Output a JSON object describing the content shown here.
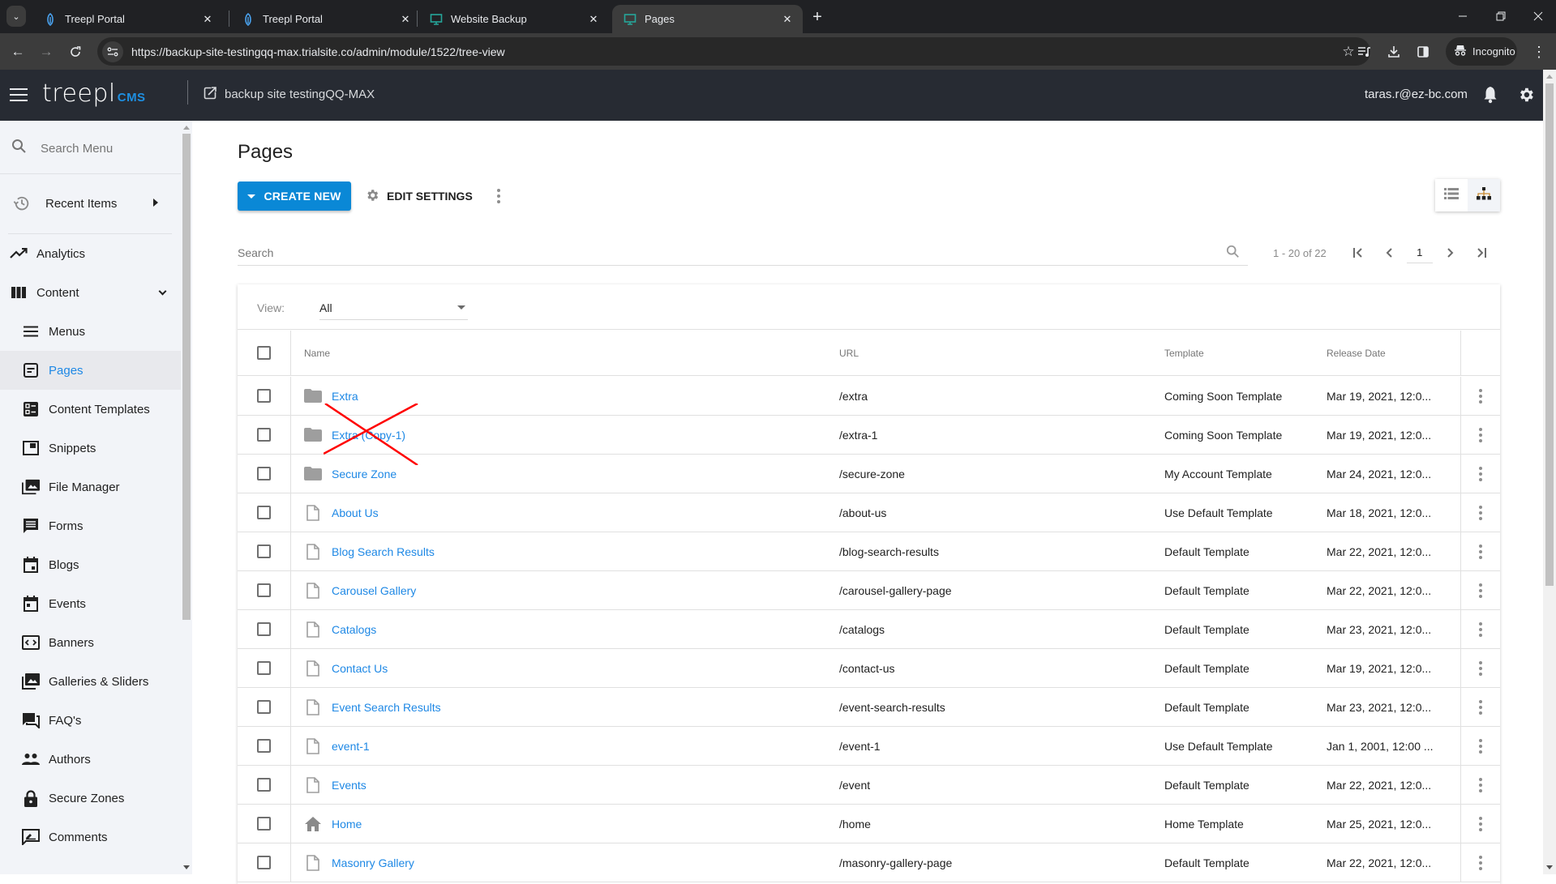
{
  "browser": {
    "tabs": [
      {
        "title": "Treepl Portal",
        "icon": "treepl-favicon",
        "active": false
      },
      {
        "title": "Treepl Portal",
        "icon": "treepl-favicon",
        "active": false
      },
      {
        "title": "Website Backup",
        "icon": "monitor-favicon",
        "active": false
      },
      {
        "title": "Pages",
        "icon": "monitor-favicon",
        "active": true
      }
    ],
    "url": "https://backup-site-testingqq-max.trialsite.co/admin/module/1522/tree-view",
    "incognito_label": "Incognito",
    "close_glyph": "✕",
    "new_tab_glyph": "+"
  },
  "header": {
    "logo_text": "treepl",
    "logo_suffix": "CMS",
    "site_name": "backup site testingQQ-MAX",
    "user_email": "taras.r@ez-bc.com"
  },
  "sidebar": {
    "search_placeholder": "Search Menu",
    "recent_items_label": "Recent Items",
    "items": [
      {
        "label": "Analytics",
        "icon": "trending-up-icon",
        "level": "top"
      },
      {
        "label": "Content",
        "icon": "columns-icon",
        "level": "top",
        "expanded": true
      },
      {
        "label": "Menus",
        "icon": "menu-lines-icon",
        "level": "sub"
      },
      {
        "label": "Pages",
        "icon": "page-icon",
        "level": "sub",
        "active": true
      },
      {
        "label": "Content Templates",
        "icon": "content-templates-icon",
        "level": "sub"
      },
      {
        "label": "Snippets",
        "icon": "snippets-icon",
        "level": "sub"
      },
      {
        "label": "File Manager",
        "icon": "file-manager-icon",
        "level": "sub"
      },
      {
        "label": "Forms",
        "icon": "forms-icon",
        "level": "sub"
      },
      {
        "label": "Blogs",
        "icon": "calendar-icon",
        "level": "sub"
      },
      {
        "label": "Events",
        "icon": "calendar-event-icon",
        "level": "sub"
      },
      {
        "label": "Banners",
        "icon": "banners-icon",
        "level": "sub"
      },
      {
        "label": "Galleries & Sliders",
        "icon": "galleries-icon",
        "level": "sub"
      },
      {
        "label": "FAQ's",
        "icon": "forum-icon",
        "level": "sub"
      },
      {
        "label": "Authors",
        "icon": "people-icon",
        "level": "sub"
      },
      {
        "label": "Secure Zones",
        "icon": "lock-icon",
        "level": "sub"
      },
      {
        "label": "Comments",
        "icon": "comment-icon",
        "level": "sub"
      }
    ]
  },
  "main": {
    "title": "Pages",
    "create_new_label": "CREATE NEW",
    "edit_settings_label": "EDIT SETTINGS",
    "search_placeholder": "Search",
    "pagination": {
      "range_text": "1 - 20 of 22",
      "current_page": "1"
    },
    "view_filter": {
      "label": "View:",
      "selected": "All"
    },
    "table": {
      "columns": [
        "Name",
        "URL",
        "Template",
        "Release Date"
      ],
      "rows": [
        {
          "name": "Extra",
          "type": "folder",
          "url": "/extra",
          "template": "Coming Soon Template",
          "release_date": "Mar 19, 2021, 12:0..."
        },
        {
          "name": "Extra (Copy-1)",
          "type": "folder",
          "url": "/extra-1",
          "template": "Coming Soon Template",
          "release_date": "Mar 19, 2021, 12:0..."
        },
        {
          "name": "Secure Zone",
          "type": "folder",
          "url": "/secure-zone",
          "template": "My Account Template",
          "release_date": "Mar 24, 2021, 12:0..."
        },
        {
          "name": "About Us",
          "type": "page",
          "url": "/about-us",
          "template": "Use Default Template",
          "release_date": "Mar 18, 2021, 12:0..."
        },
        {
          "name": "Blog Search Results",
          "type": "page",
          "url": "/blog-search-results",
          "template": "Default Template",
          "release_date": "Mar 22, 2021, 12:0..."
        },
        {
          "name": "Carousel Gallery",
          "type": "page",
          "url": "/carousel-gallery-page",
          "template": "Default Template",
          "release_date": "Mar 22, 2021, 12:0..."
        },
        {
          "name": "Catalogs",
          "type": "page",
          "url": "/catalogs",
          "template": "Default Template",
          "release_date": "Mar 23, 2021, 12:0..."
        },
        {
          "name": "Contact Us",
          "type": "page",
          "url": "/contact-us",
          "template": "Default Template",
          "release_date": "Mar 19, 2021, 12:0..."
        },
        {
          "name": "Event Search Results",
          "type": "page",
          "url": "/event-search-results",
          "template": "Default Template",
          "release_date": "Mar 23, 2021, 12:0..."
        },
        {
          "name": "event-1",
          "type": "page",
          "url": "/event-1",
          "template": "Use Default Template",
          "release_date": "Jan 1, 2001, 12:00 ..."
        },
        {
          "name": "Events",
          "type": "page",
          "url": "/event",
          "template": "Default Template",
          "release_date": "Mar 22, 2021, 12:0..."
        },
        {
          "name": "Home",
          "type": "home",
          "url": "/home",
          "template": "Home Template",
          "release_date": "Mar 25, 2021, 12:0..."
        },
        {
          "name": "Masonry Gallery",
          "type": "page",
          "url": "/masonry-gallery-page",
          "template": "Default Template",
          "release_date": "Mar 22, 2021, 12:0..."
        }
      ]
    }
  },
  "annotation": {
    "type": "red-x-mark",
    "target_row": "Extra (Copy-1)",
    "color": "#ff0000"
  },
  "colors": {
    "accent": "#1e88e5",
    "primary_button": "#0a88d6",
    "header_bg": "#272b33",
    "sidebar_bg": "#f2f4f8"
  }
}
